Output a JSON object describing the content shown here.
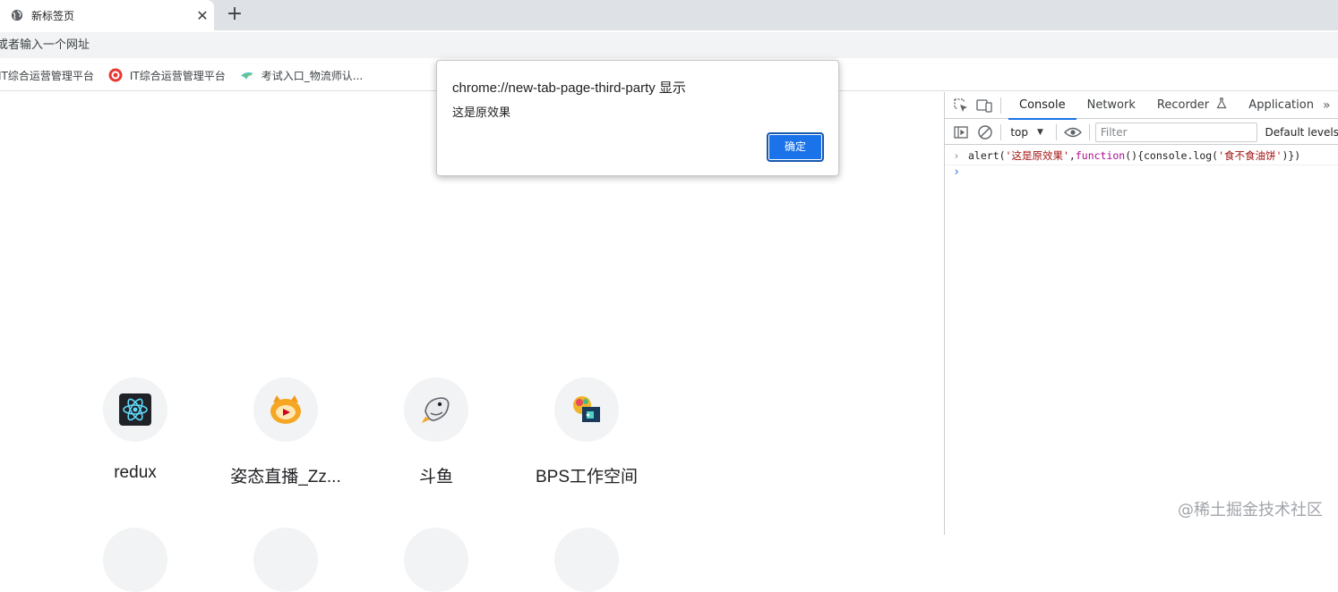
{
  "browser": {
    "tab_title": "新标签页",
    "tab_close": "✕",
    "new_tab": "+",
    "omnibox_placeholder": "或者输入一个网址"
  },
  "bookmarks": [
    {
      "label": "IT综合运营管理平台",
      "icon": "site-icon"
    },
    {
      "label": "IT综合运营管理平台",
      "icon": "red-gear-icon"
    },
    {
      "label": "考试入口_物流师认...",
      "icon": "bird-icon"
    }
  ],
  "shortcuts": [
    {
      "label": "redux",
      "icon": "react-atom-icon"
    },
    {
      "label": "姿态直播_Zz...",
      "icon": "orange-mascot-icon"
    },
    {
      "label": "斗鱼",
      "icon": "douyu-fish-icon"
    },
    {
      "label": "BPS工作空间",
      "icon": "bps-icon"
    }
  ],
  "dialog": {
    "title": "chrome://new-tab-page-third-party 显示",
    "message": "这是原效果",
    "ok_label": "确定"
  },
  "devtools": {
    "tabs": [
      "Console",
      "Network",
      "Recorder",
      "Application"
    ],
    "active_tab": "Console",
    "context": "top",
    "filter_placeholder": "Filter",
    "levels_label": "Default levels",
    "console_input": {
      "ident": "alert(",
      "str1": "'这是原效果'",
      "comma": ",",
      "kw": "function",
      "rest": "(){console.log(",
      "str2": "'食不食油饼'",
      "close": ")})"
    }
  },
  "watermark": "@稀土掘金技术社区",
  "colors": {
    "accent": "#1a73e8",
    "tabstrip": "#dee1e6",
    "omnibox": "#f1f3f4"
  }
}
